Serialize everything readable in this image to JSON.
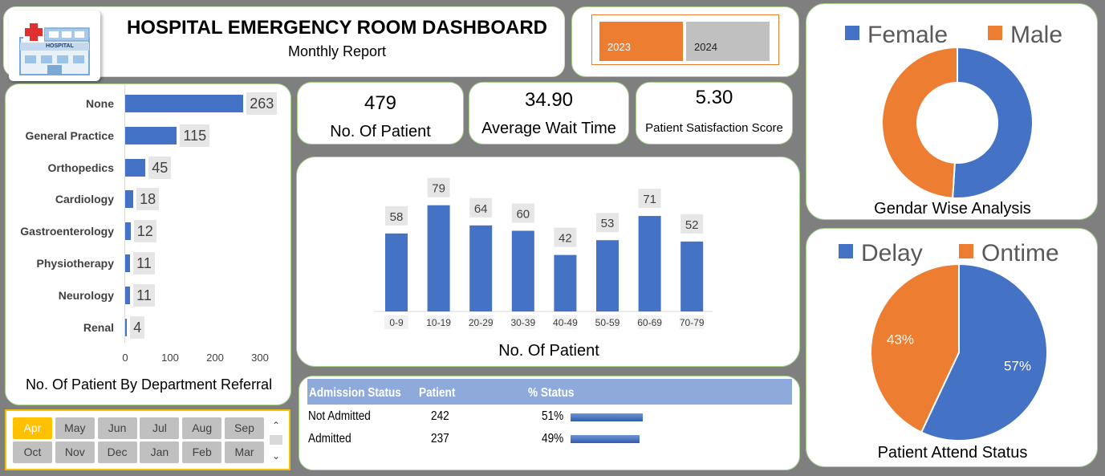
{
  "header": {
    "title": "HOSPITAL EMERGENCY ROOM DASHBOARD",
    "subtitle": "Monthly Report",
    "logo_text": "HOSPITAL"
  },
  "year_slicer": {
    "items": [
      {
        "label": "2023",
        "selected": true
      },
      {
        "label": "2024",
        "selected": false
      }
    ]
  },
  "kpis": {
    "patients": {
      "value": "479",
      "label": "No. Of Patient"
    },
    "wait": {
      "value": "34.90",
      "label": "Average Wait Time"
    },
    "satisfaction": {
      "value": "5.30",
      "label": "Patient Satisfaction Score"
    }
  },
  "dept_chart": {
    "title": "No. Of Patient By Department Referral",
    "ticks": [
      "0",
      "100",
      "200",
      "300"
    ]
  },
  "age_chart": {
    "title": "No. Of Patient"
  },
  "months": {
    "row1": [
      "Apr",
      "May",
      "Jun",
      "Jul",
      "Aug",
      "Sep"
    ],
    "row2": [
      "Oct",
      "Nov",
      "Dec",
      "Jan",
      "Feb",
      "Mar"
    ],
    "selected": "Apr"
  },
  "admission": {
    "headers": [
      "Admission Status",
      "Patient",
      "% Status"
    ],
    "rows": [
      {
        "status": "Not Admitted",
        "patients": "242",
        "pct": "51%",
        "fraction": 0.51
      },
      {
        "status": "Admitted",
        "patients": "237",
        "pct": "49%",
        "fraction": 0.49
      }
    ]
  },
  "gender": {
    "title": "Gendar Wise Analysis",
    "legend": [
      "Female",
      "Male"
    ]
  },
  "attend": {
    "title": "Patient Attend Status",
    "legend": [
      "Delay",
      "Ontime"
    ]
  },
  "colors": {
    "blue": "#4472c4",
    "orange": "#ed7d31",
    "gold": "#ffc000"
  },
  "chart_data": [
    {
      "type": "bar",
      "orientation": "horizontal",
      "title": "No. Of Patient By Department Referral",
      "categories": [
        "None",
        "General Practice",
        "Orthopedics",
        "Cardiology",
        "Gastroenterology",
        "Physiotherapy",
        "Neurology",
        "Renal"
      ],
      "values": [
        263,
        115,
        45,
        18,
        12,
        11,
        11,
        4
      ],
      "xlim": [
        0,
        300
      ]
    },
    {
      "type": "bar",
      "title": "No. Of Patient",
      "categories": [
        "0-9",
        "10-19",
        "20-29",
        "30-39",
        "40-49",
        "50-59",
        "60-69",
        "70-79"
      ],
      "values": [
        58,
        79,
        64,
        60,
        42,
        53,
        71,
        52
      ],
      "ylim": [
        0,
        80
      ]
    },
    {
      "type": "pie",
      "title": "Gendar Wise Analysis",
      "categories": [
        "Female",
        "Male"
      ],
      "values": [
        51,
        49
      ]
    },
    {
      "type": "pie",
      "title": "Patient Attend Status",
      "categories": [
        "Delay",
        "Ontime"
      ],
      "values": [
        57,
        43
      ],
      "labels": [
        "57%",
        "43%"
      ]
    }
  ]
}
